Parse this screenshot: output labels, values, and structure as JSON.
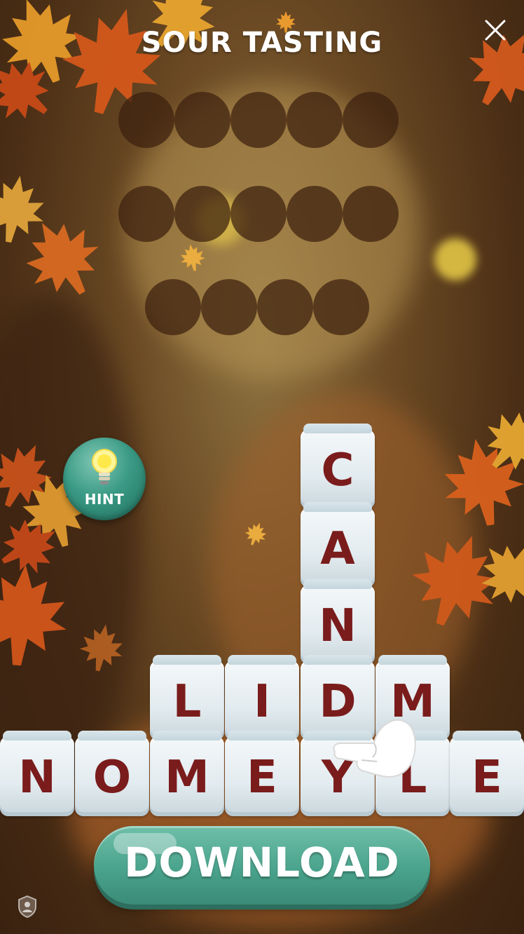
{
  "title": "SOUR TASTING",
  "close_icon": "close-icon",
  "hint": {
    "label": "HINT",
    "icon": "lightbulb-icon"
  },
  "answer_rows": [
    {
      "letters": 5
    },
    {
      "letters": 5
    },
    {
      "letters": 4
    }
  ],
  "tiles": {
    "column": [
      "C",
      "A",
      "N"
    ],
    "row1": [
      "L",
      "I",
      "D",
      "M"
    ],
    "row2": [
      "N",
      "O",
      "M",
      "E",
      "Y",
      "L",
      "E"
    ]
  },
  "download": {
    "label": "DOWNLOAD"
  },
  "colors": {
    "tile_letter": "#7a1c1c",
    "button": "#4aa38c",
    "slot": "#3c200e"
  },
  "icons": [
    "close-icon",
    "lightbulb-icon",
    "pointing-hand-icon",
    "shield-user-icon",
    "maple-leaf-icon"
  ]
}
